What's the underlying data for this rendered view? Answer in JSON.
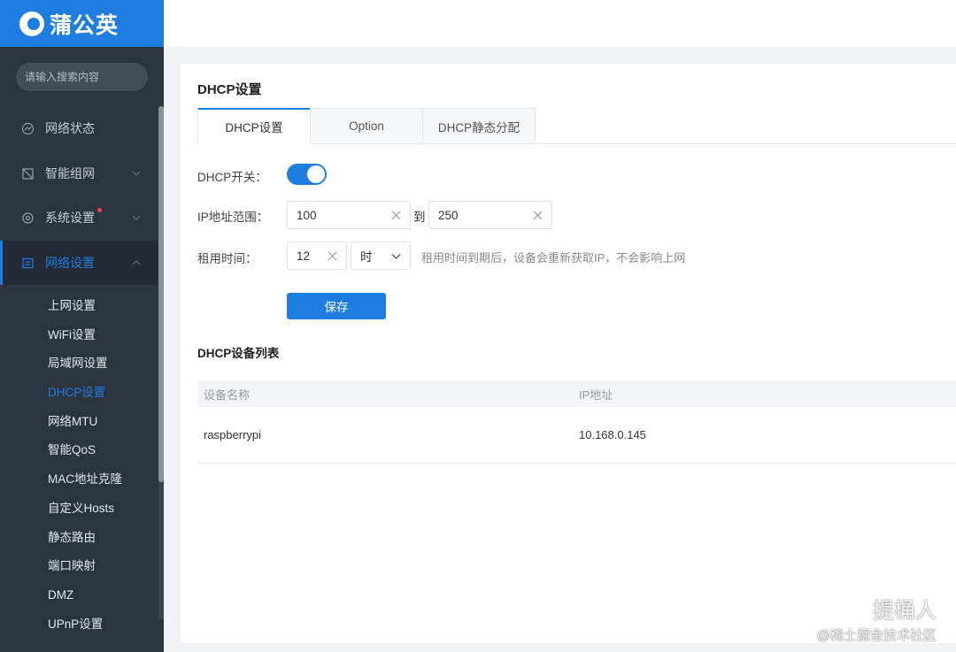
{
  "app": {
    "logo_text": "蒲公英"
  },
  "search": {
    "placeholder": "请输入搜索内容"
  },
  "sidebar": {
    "items": [
      {
        "label": "网络状态",
        "icon": "status-icon"
      },
      {
        "label": "智能组网",
        "icon": "network-group-icon"
      },
      {
        "label": "系统设置",
        "icon": "gear-icon"
      },
      {
        "label": "网络设置",
        "icon": "network-settings-icon"
      }
    ],
    "sub_items": [
      "上网设置",
      "WiFi设置",
      "局域网设置",
      "DHCP设置",
      "网络MTU",
      "智能QoS",
      "MAC地址克隆",
      "自定义Hosts",
      "静态路由",
      "端口映射",
      "DMZ",
      "UPnP设置"
    ]
  },
  "page": {
    "title": "DHCP设置"
  },
  "tabs": [
    "DHCP设置",
    "Option",
    "DHCP静态分配"
  ],
  "form": {
    "switch_label": "DHCP开关：",
    "switch_on": true,
    "range_label": "IP地址范围：",
    "range_start": "100",
    "range_to": "到",
    "range_end": "250",
    "lease_label": "租用时间：",
    "lease_value": "12",
    "lease_unit": "时",
    "lease_hint": "租用时间到期后，设备会重新获取IP，不会影响上网",
    "save_label": "保存"
  },
  "device_list": {
    "title": "DHCP设备列表",
    "columns": [
      "设备名称",
      "IP地址"
    ],
    "rows": [
      {
        "name": "raspberrypi",
        "ip": "10.168.0.145"
      }
    ]
  },
  "watermark": {
    "line1": "提桶人",
    "line2": "@稀土掘金技术社区"
  },
  "colors": {
    "accent": "#1e7ee0",
    "sidebar_bg": "#2c3440",
    "alert_dot": "#f04848"
  }
}
